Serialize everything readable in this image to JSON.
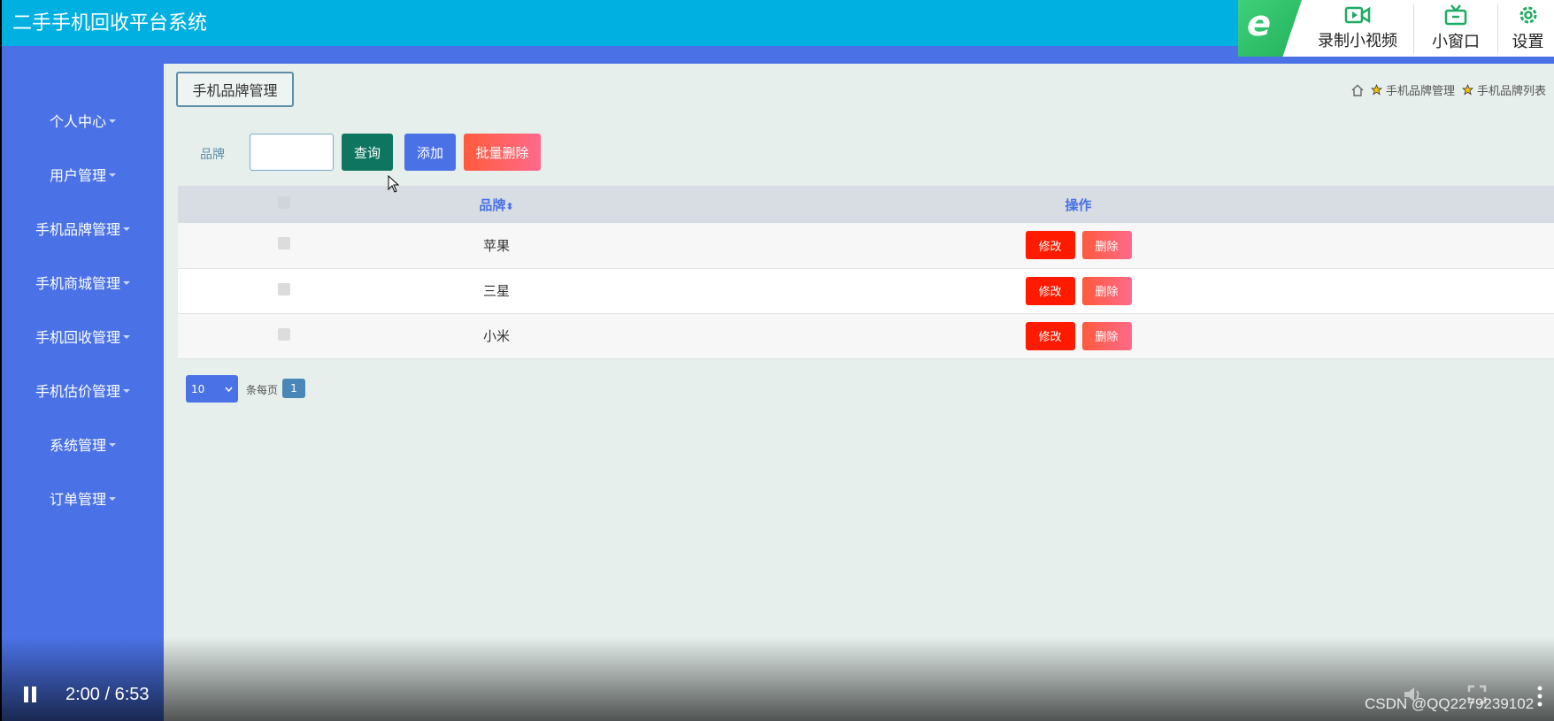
{
  "app": {
    "title": "二手手机回收平台系统"
  },
  "overlay": {
    "record_label": "录制小视频",
    "mini_window_label": "小窗口",
    "settings_label": "设置"
  },
  "sidebar": {
    "items": [
      {
        "label": "个人中心"
      },
      {
        "label": "用户管理"
      },
      {
        "label": "手机品牌管理"
      },
      {
        "label": "手机商城管理"
      },
      {
        "label": "手机回收管理"
      },
      {
        "label": "手机估价管理"
      },
      {
        "label": "系统管理"
      },
      {
        "label": "订单管理"
      }
    ]
  },
  "page": {
    "tab_label": "手机品牌管理",
    "breadcrumb": [
      "手机品牌管理",
      "手机品牌列表"
    ]
  },
  "search": {
    "label": "品牌",
    "value": "",
    "query_label": "查询",
    "add_label": "添加",
    "batch_delete_label": "批量删除"
  },
  "table": {
    "columns": {
      "brand": "品牌",
      "sort_icon": "⬍",
      "operation": "操作"
    },
    "rows": [
      {
        "brand": "苹果",
        "edit": "修改",
        "delete": "删除"
      },
      {
        "brand": "三星",
        "edit": "修改",
        "delete": "删除"
      },
      {
        "brand": "小米",
        "edit": "修改",
        "delete": "删除"
      }
    ]
  },
  "pagination": {
    "page_size": "10",
    "per_page_label": "条每页",
    "current_page": "1"
  },
  "video": {
    "timecode": "2:00 / 6:53",
    "watermark": "CSDN @QQ2279239102"
  },
  "colors": {
    "header": "#00b0e0",
    "sidebar": "#4a72e6",
    "content_bg": "#e6efec",
    "query": "#0e7560",
    "edit": "#ff1a00"
  }
}
